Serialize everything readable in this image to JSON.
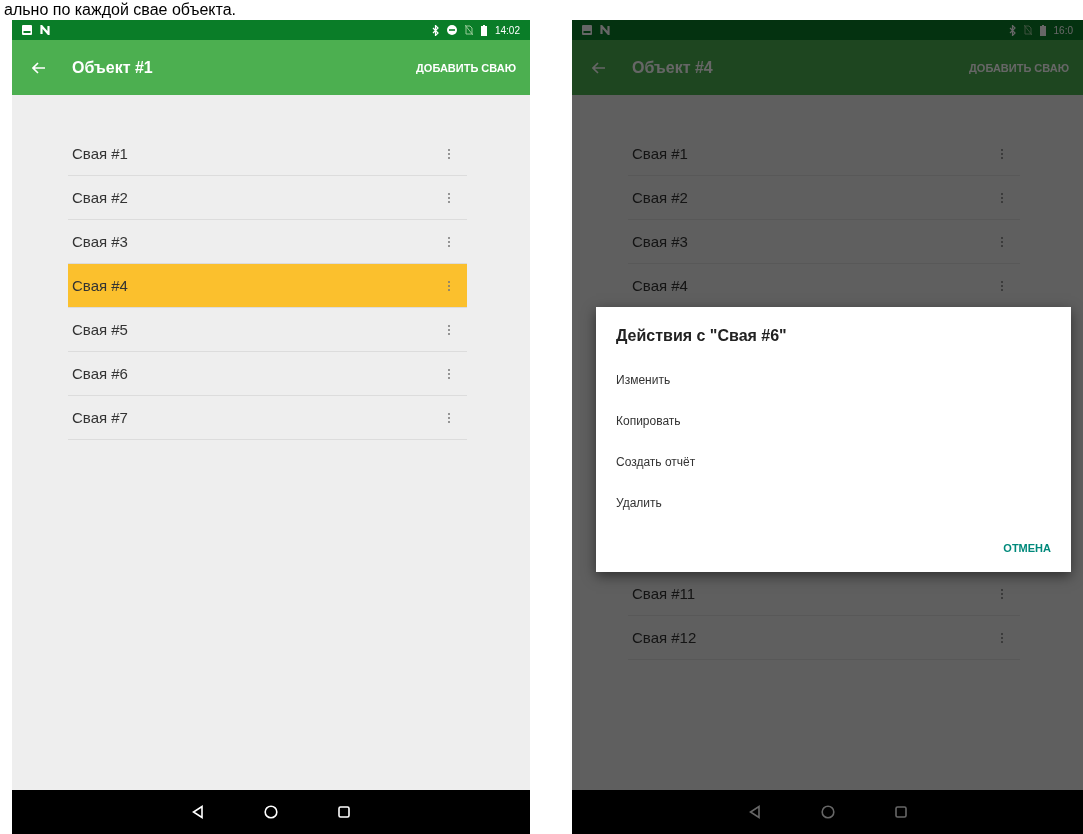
{
  "caption": "ально по каждой свае объекта.",
  "phones": [
    {
      "status_time": "14:02",
      "status_icons": [
        {
          "kind": "bluetooth"
        },
        {
          "kind": "dnd"
        },
        {
          "kind": "nosim"
        },
        {
          "kind": "battery"
        }
      ],
      "title": "Объект #1",
      "action": "ДОБАВИТЬ СВАЮ",
      "items": [
        {
          "label": "Свая #1",
          "selected": false
        },
        {
          "label": "Свая #2",
          "selected": false
        },
        {
          "label": "Свая #3",
          "selected": false
        },
        {
          "label": "Свая #4",
          "selected": true
        },
        {
          "label": "Свая #5",
          "selected": false
        },
        {
          "label": "Свая #6",
          "selected": false
        },
        {
          "label": "Свая #7",
          "selected": false
        }
      ]
    },
    {
      "status_time": "16:0",
      "status_icons": [
        {
          "kind": "bluetooth"
        },
        {
          "kind": "nosim"
        },
        {
          "kind": "battery"
        }
      ],
      "title": "Объект #4",
      "action": "ДОБАВИТЬ СВАЮ",
      "items": [
        {
          "label": "Свая #1",
          "selected": false
        },
        {
          "label": "Свая #2",
          "selected": false
        },
        {
          "label": "Свая #3",
          "selected": false
        },
        {
          "label": "Свая #4",
          "selected": false
        }
      ],
      "items_after_dialog": [
        {
          "label": "Свая #11",
          "selected": false
        },
        {
          "label": "Свая #12",
          "selected": false
        }
      ],
      "dialog": {
        "title": "Действия с \"Свая #6\"",
        "actions": [
          "Изменить",
          "Копировать",
          "Создать отчёт",
          "Удалить"
        ],
        "cancel": "ОТМЕНА"
      }
    }
  ]
}
